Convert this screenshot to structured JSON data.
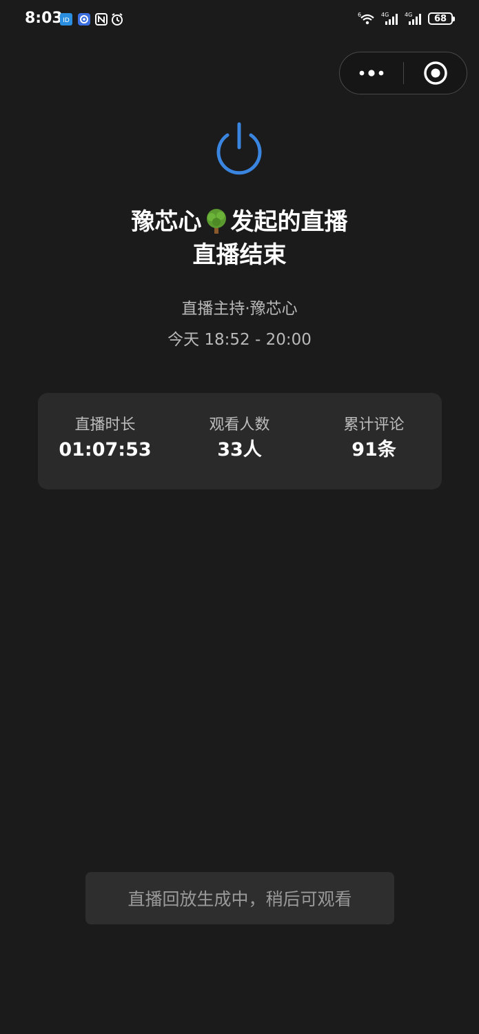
{
  "status_bar": {
    "time": "8:03",
    "notification_icons": [
      "app-icon-blue",
      "app-icon-circle",
      "nfc-icon",
      "alarm-icon"
    ],
    "network_labels": [
      "6",
      "4G",
      "4G"
    ],
    "battery_level": "68"
  },
  "capsule": {
    "more_icon": "more-dots-icon",
    "close_icon": "target-close-icon"
  },
  "header": {
    "icon": "power-icon",
    "title_prefix": "豫芯心",
    "title_emoji": "tree-emoji",
    "title_suffix": "发起的直播",
    "subtitle": "直播结束",
    "host": "直播主持·豫芯心",
    "time_range": "今天 18:52 - 20:00"
  },
  "stats": [
    {
      "label": "直播时长",
      "value": "01:07:53"
    },
    {
      "label": "观看人数",
      "value": "33人"
    },
    {
      "label": "累计评论",
      "value": "91条"
    }
  ],
  "toast": {
    "text": "直播回放生成中，稍后可观看"
  },
  "colors": {
    "background": "#1b1b1b",
    "accent_blue": "#3a85e0",
    "card": "#2a2a2a"
  }
}
